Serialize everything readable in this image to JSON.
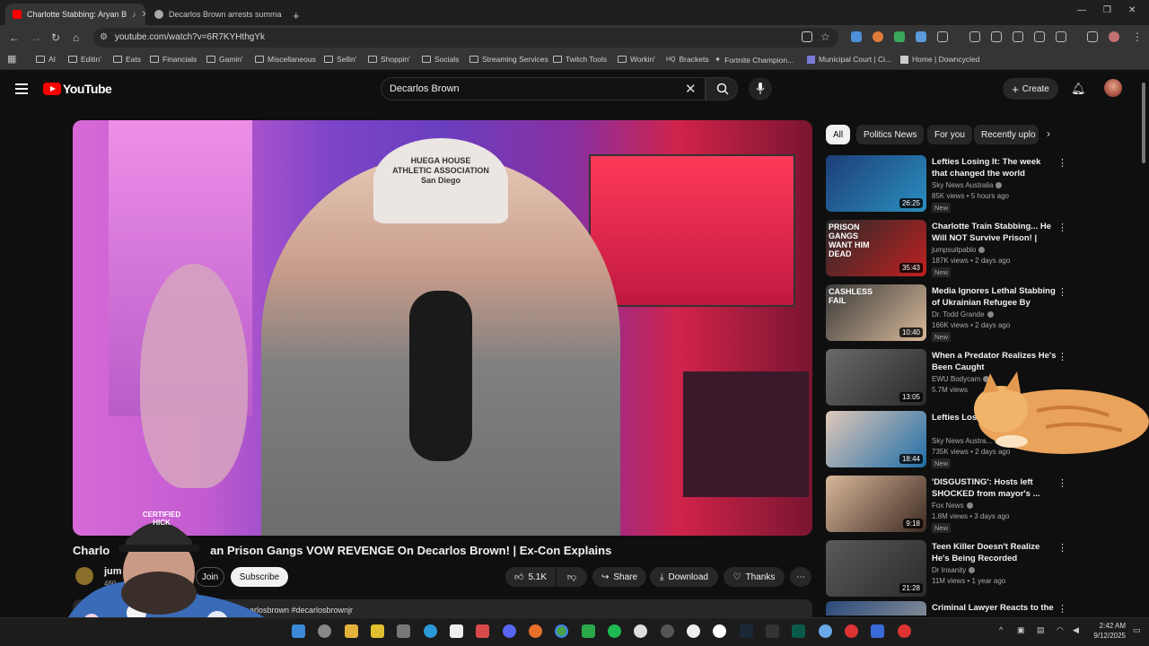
{
  "browser": {
    "tabs": [
      {
        "label": "Charlotte Stabbing: Aryan B",
        "active": true
      },
      {
        "label": "Decarlos Brown arrests summa",
        "active": false
      }
    ],
    "new_tab": "+",
    "url": "youtube.com/watch?v=6R7KYHthgYk",
    "bookmarks": [
      "AI",
      "Editin'",
      "Eats",
      "Financials",
      "Gamin'",
      "Miscellaneous",
      "Sellin'",
      "Shoppin'",
      "Socials",
      "Streaming Services",
      "Twitch Tools",
      "Workin'",
      "Brackets",
      "Fortnite Champion...",
      "Municipal Court | Ci...",
      "Home | Downcycled"
    ]
  },
  "youtube": {
    "logo_text": "YouTube",
    "search_query": "Decarlos Brown",
    "create_label": "Create"
  },
  "player": {
    "hat_text": "HUEGA HOUSE\nATHLETIC ASSOCIATION\nSan Diego"
  },
  "video": {
    "title_visible_start": "Charlo",
    "title_visible_end": "an Prison Gangs VOW REVENGE On Decarlos Brown! | Ex-Con Explains",
    "channel_partial": "jum",
    "subs_partial": "460",
    "join_label": "Join",
    "subscribe_label": "Subscribe",
    "likes": "5.1K",
    "share_label": "Share",
    "download_label": "Download",
    "thanks_label": "Thanks",
    "description_partial": "arlosbrown #decarlosbrownjr"
  },
  "chips": [
    "All",
    "Politics News",
    "For you",
    "Recently uplo"
  ],
  "recommendations": [
    {
      "title": "Lefties Losing It: The week that changed the world",
      "channel": "Sky News Australia",
      "meta": "85K views • 5 hours ago",
      "badge": "New",
      "duration": "26:25",
      "colors": [
        "#1d3e78",
        "#2a8fbf"
      ]
    },
    {
      "title": "Charlotte Train Stabbing... He Will NOT Survive Prison! | Ex-...",
      "channel": "jumpsuitpablo",
      "meta": "187K views • 2 days ago",
      "badge": "New",
      "duration": "35:43",
      "colors": [
        "#2a2a2a",
        "#c02020"
      ],
      "thumb_text": "PRISON GANGS WANT HIM DEAD"
    },
    {
      "title": "Media Ignores Lethal Stabbing of Ukrainian Refugee By Care...",
      "channel": "Dr. Todd Grande",
      "meta": "166K views • 2 days ago",
      "badge": "New",
      "duration": "10:40",
      "colors": [
        "#3a3a3a",
        "#d7b898"
      ],
      "thumb_text": "CASHLESS FAIL"
    },
    {
      "title": "When a Predator Realizes He's Been Caught",
      "channel": "EWU Bodycam",
      "meta": "5.7M views",
      "badge": "",
      "duration": "13:05",
      "colors": [
        "#6a6a6a",
        "#2a2a2a"
      ]
    },
    {
      "title": "Lefties Losing It: mayor's c...",
      "channel": "Sky News Austra...",
      "meta": "735K views • 2 days ago",
      "badge": "New",
      "duration": "18:44",
      "colors": [
        "#e0c8b8",
        "#1f6ea8"
      ]
    },
    {
      "title": "'DISGUSTING': Hosts left SHOCKED from mayor's ...",
      "channel": "Fox News",
      "meta": "1.8M views • 3 days ago",
      "badge": "New",
      "duration": "9:18",
      "colors": [
        "#d9b89a",
        "#3d2a22"
      ]
    },
    {
      "title": "Teen Killer Doesn't Realize He's Being Recorded",
      "channel": "Dr Insanity",
      "meta": "11M views • 1 year ago",
      "badge": "",
      "duration": "21:28",
      "colors": [
        "#5a5a5a",
        "#2b2b2b"
      ]
    },
    {
      "title": "Criminal Lawyer Reacts to the",
      "channel": "",
      "meta": "",
      "badge": "",
      "duration": "",
      "colors": [
        "#2a4a7a",
        "#a0a0a0"
      ]
    }
  ],
  "overlays": {
    "streamer_hat_text": "CERTIFIED HICK"
  },
  "taskbar": {
    "time": "2:42 AM",
    "date": "9/12/2025"
  }
}
